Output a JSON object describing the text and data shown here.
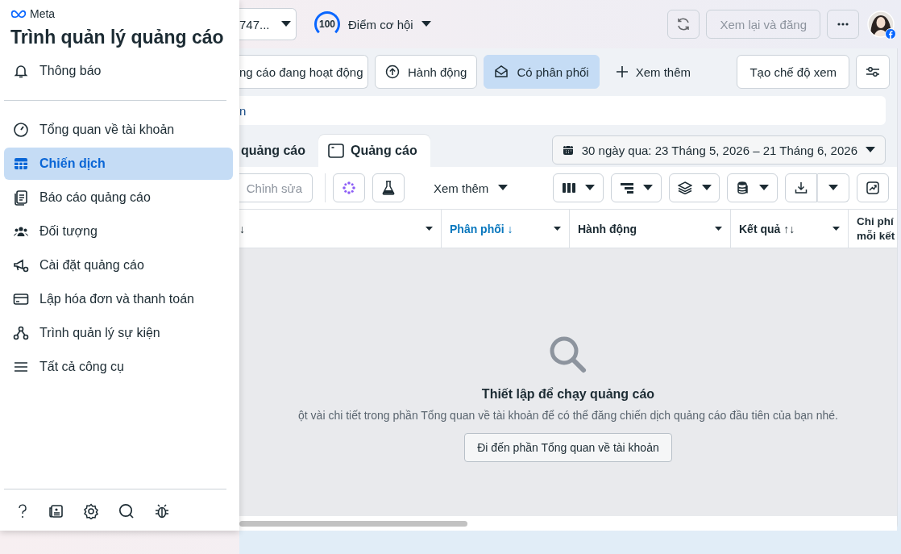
{
  "sidebar": {
    "brand": "Meta",
    "title": "Trình quản lý quảng cáo",
    "notifications": "Thông báo",
    "items": [
      {
        "label": "Tổng quan về tài khoản",
        "selected": false
      },
      {
        "label": "Chiến dịch",
        "selected": true
      },
      {
        "label": "Báo cáo quảng cáo",
        "selected": false
      },
      {
        "label": "Đối tượng",
        "selected": false
      },
      {
        "label": "Cài đặt quảng cáo",
        "selected": false
      },
      {
        "label": "Lập hóa đơn và thanh toán",
        "selected": false
      },
      {
        "label": "Trình quản lý sự kiện",
        "selected": false
      },
      {
        "label": "Tất cả công cụ",
        "selected": false
      }
    ]
  },
  "topbar": {
    "account": "747...",
    "score": "100",
    "score_label": "Điểm cơ hội",
    "review_button": {
      "label": "Xem lại và đăng",
      "disabled": true
    }
  },
  "filters": [
    {
      "label": "ng cáo đang hoạt động",
      "selected": false
    },
    {
      "label": "Hành động",
      "selected": false
    },
    {
      "label": "Có phân phối",
      "selected": true
    }
  ],
  "filters_more": "Xem thêm",
  "create_view": "Tạo chế độ xem",
  "search": {
    "placeholder": "n"
  },
  "tabs": [
    {
      "label": "quảng cáo",
      "selected": false
    },
    {
      "label": "Quảng cáo",
      "selected": true
    }
  ],
  "date_range": "30 ngày qua: 23 Tháng 5, 2026 – 21 Tháng 6, 2026",
  "toolbar": {
    "edit": {
      "label": "Chỉnh sửa",
      "disabled": true
    },
    "more": "Xem thêm"
  },
  "table": {
    "columns": [
      {
        "label": "↓",
        "sorted": false
      },
      {
        "label": "Phân phối ↓",
        "sorted": true
      },
      {
        "label": "Hành động",
        "sorted": false
      },
      {
        "label": "Kết quả ↑↓",
        "sorted": false
      },
      {
        "label": "Chi phí mỗi kết",
        "sorted": false
      }
    ]
  },
  "empty_state": {
    "title": "Thiết lập để chạy quảng cáo",
    "text": "ột vài chi tiết trong phần Tổng quan về tài khoản để có thể đăng chiến dịch quảng cáo đầu tiên của bạn nhé.",
    "button": "Đi đến phần Tổng quan về tài khoản"
  }
}
